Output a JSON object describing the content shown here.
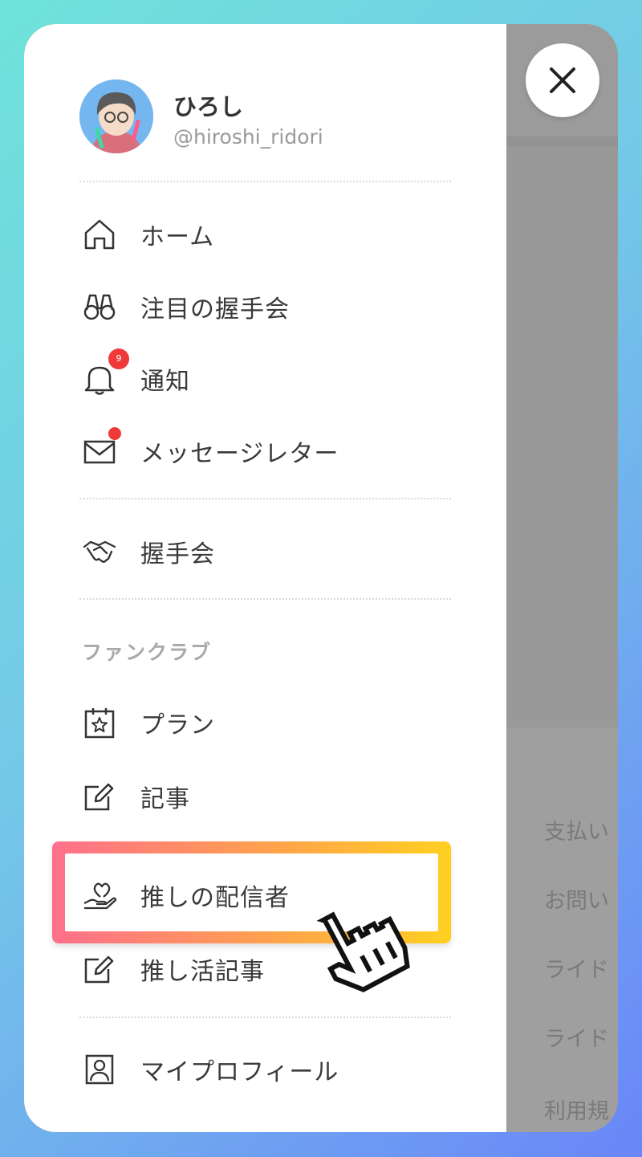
{
  "user": {
    "name": "ひろし",
    "handle": "@hiroshi_ridori"
  },
  "menu": {
    "home": "ホーム",
    "featured": "注目の握手会",
    "notifications": {
      "label": "通知",
      "badge": "9"
    },
    "letters": "メッセージレター",
    "handshake": "握手会"
  },
  "fanclub": {
    "heading": "ファンクラブ",
    "plan": "プラン",
    "articles": "記事",
    "favorite_streamers": "推しの配信者",
    "oshi_articles": "推し活記事"
  },
  "profile": "マイプロフィール",
  "background_links": [
    "支払い",
    "お問い",
    "ライド",
    "ライド",
    "利用規"
  ],
  "colors": {
    "badge_red": "#f03a3a",
    "highlight_gradient": [
      "#ff6f8c",
      "#ffa24d",
      "#ffd020"
    ],
    "frame_gradient": [
      "#6fe3da",
      "#6a86f8"
    ]
  }
}
